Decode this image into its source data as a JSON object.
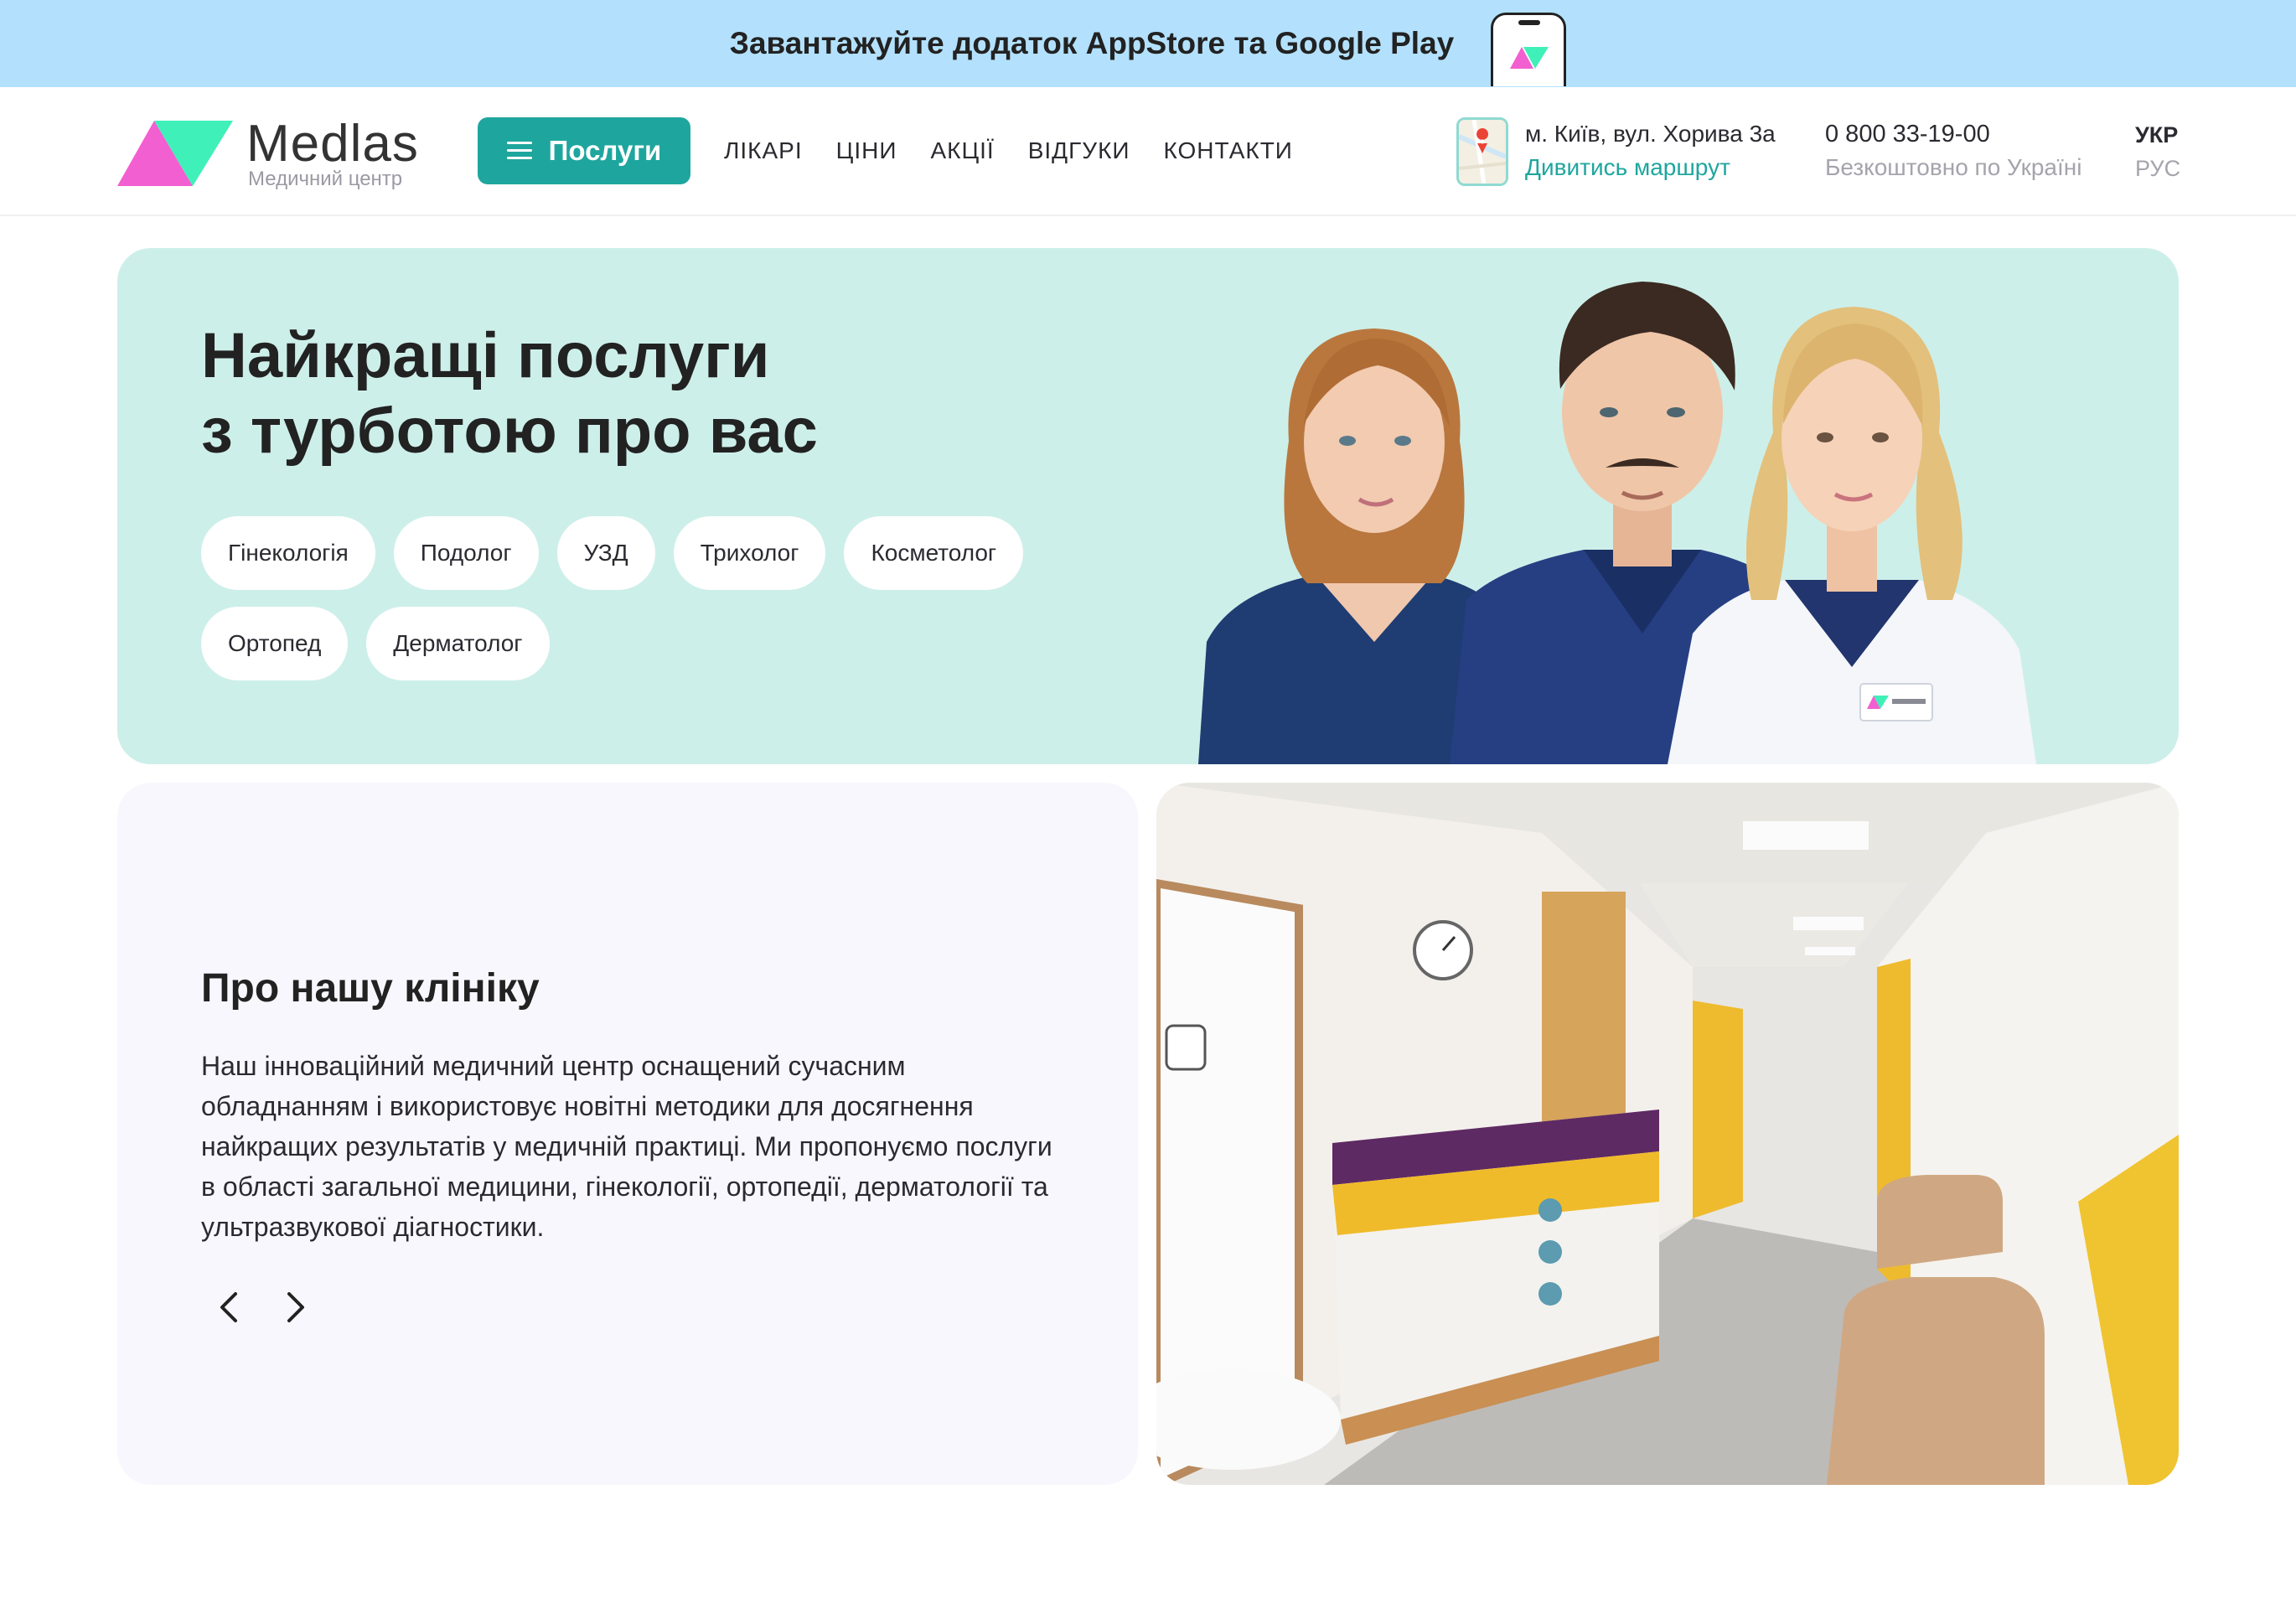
{
  "banner": {
    "text": "Завантажуйте додаток AppStore та Google Play"
  },
  "header": {
    "logo_name": "Medlas",
    "logo_sub": "Медичний центр",
    "services_label": "Послуги",
    "nav": [
      "ЛІКАРІ",
      "ЦІНИ",
      "АКЦІЇ",
      "ВІДГУКИ",
      "КОНТАКТИ"
    ],
    "address": "м. Київ, вул. Хорива 3а",
    "route_label": "Дивитись маршрут",
    "phone": "0 800 33-19-00",
    "phone_note": "Безкоштовно по Україні",
    "lang_active": "УКР",
    "lang_other": "РУС"
  },
  "hero": {
    "title_line1": "Найкращі послуги",
    "title_line2": "з турботою про вас",
    "chips": [
      "Гінекологія",
      "Подолог",
      "УЗД",
      "Трихолог",
      "Косметолог",
      "Ортопед",
      "Дерматолог"
    ]
  },
  "about": {
    "title": "Про нашу клініку",
    "text": "Наш інноваційний медичний центр оснащений сучасним обладнанням і використовує новітні методики для досягнення найкращих результатів у медичній практиці. Ми пропонуємо послуги в області загальної медицини, гінекології, ортопедії, дерматології та ультразвукової діагностики."
  },
  "colors": {
    "banner_bg": "#b3e1fd",
    "accent": "#1ea69e",
    "hero_bg": "#cdefe9",
    "card_bg": "#f8f7fd",
    "logo_pink": "#f25fd0",
    "logo_green": "#3ff0b8"
  },
  "icons": [
    "phone-icon",
    "logo-triangles-icon",
    "menu-icon",
    "map-pin-icon",
    "chevron-left-icon",
    "chevron-right-icon"
  ]
}
